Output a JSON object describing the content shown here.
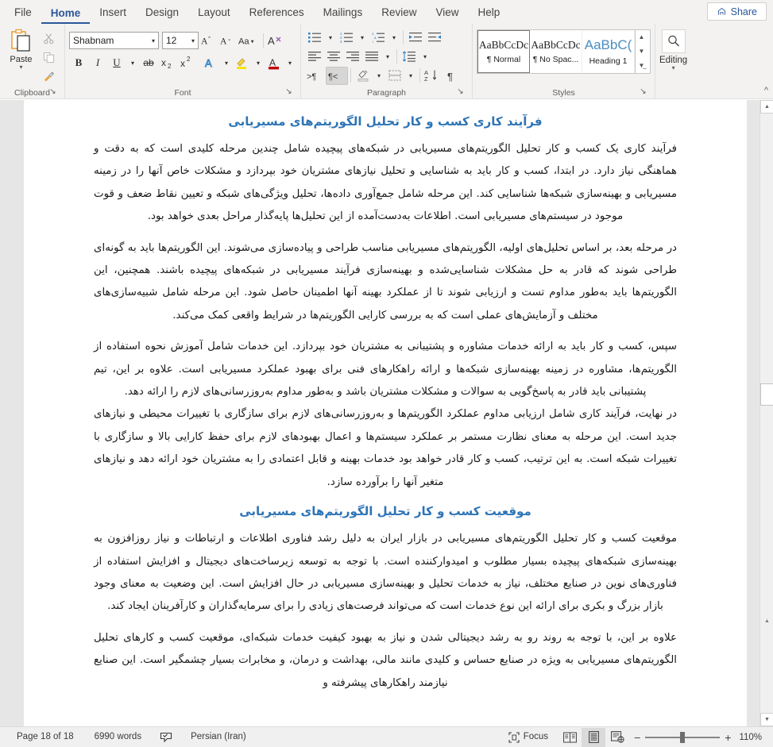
{
  "titlebar": {
    "share_label": "Share",
    "share_icon": "share-icon"
  },
  "tabs": [
    {
      "label": "File",
      "active": false
    },
    {
      "label": "Home",
      "active": true
    },
    {
      "label": "Insert",
      "active": false
    },
    {
      "label": "Design",
      "active": false
    },
    {
      "label": "Layout",
      "active": false
    },
    {
      "label": "References",
      "active": false
    },
    {
      "label": "Mailings",
      "active": false
    },
    {
      "label": "Review",
      "active": false
    },
    {
      "label": "View",
      "active": false
    },
    {
      "label": "Help",
      "active": false
    }
  ],
  "ribbon": {
    "clipboard": {
      "group_label": "Clipboard",
      "paste_label": "Paste",
      "paste_icon": "clipboard-paste-icon",
      "cut_icon": "scissors-icon",
      "copy_icon": "copy-icon",
      "format_painter_icon": "format-painter-icon",
      "dialog_launcher_icon": "dialog-launcher-icon"
    },
    "font": {
      "group_label": "Font",
      "font_name": "Shabnam",
      "font_size": "12",
      "grow_font_icon": "grow-font-icon",
      "shrink_font_icon": "shrink-font-icon",
      "change_case_icon": "change-case-icon",
      "clear_formatting_icon": "clear-formatting-icon",
      "bold_label": "B",
      "italic_label": "I",
      "underline_label": "U",
      "strikethrough_label": "ab",
      "subscript_label": "x",
      "subscript_sup": "2",
      "superscript_label": "x",
      "superscript_sup": "2",
      "text_effects_icon": "text-effects-icon",
      "highlight_icon": "text-highlight-icon",
      "font_color_icon": "font-color-icon",
      "dialog_launcher_icon": "dialog-launcher-icon"
    },
    "paragraph": {
      "group_label": "Paragraph",
      "bullets_icon": "bullet-list-icon",
      "numbering_icon": "numbered-list-icon",
      "multilevel_icon": "multilevel-list-icon",
      "decrease_indent_icon": "decrease-indent-icon",
      "increase_indent_icon": "increase-indent-icon",
      "align_left_icon": "align-left-icon",
      "align_center_icon": "align-center-icon",
      "align_right_icon": "align-right-icon",
      "justify_icon": "justify-icon",
      "line_spacing_icon": "line-spacing-icon",
      "ltr_icon": "left-to-right-text-icon",
      "rtl_icon": "right-to-left-text-icon",
      "shading_icon": "shading-icon",
      "borders_icon": "borders-icon",
      "sort_icon": "sort-icon",
      "show_marks_icon": "show-formatting-marks-icon",
      "dialog_launcher_icon": "dialog-launcher-icon"
    },
    "styles": {
      "group_label": "Styles",
      "items": [
        {
          "preview": "AaBbCcDc",
          "name": "¶ Normal",
          "selected": true
        },
        {
          "preview": "AaBbCcDc",
          "name": "¶ No Spac...",
          "selected": false
        },
        {
          "preview": "AaBbC(",
          "name": "Heading 1",
          "selected": false
        }
      ],
      "scroll_up_icon": "chevron-up-icon",
      "scroll_down_icon": "chevron-down-icon",
      "more_styles_icon": "more-styles-icon",
      "dialog_launcher_icon": "dialog-launcher-icon"
    },
    "editing": {
      "group_label": "Editing",
      "icon": "search-icon",
      "chevron_icon": "chevron-down-icon"
    },
    "collapse_icon": "collapse-ribbon-icon"
  },
  "document": {
    "blocks": [
      {
        "type": "heading",
        "text": "فرآیند کاری کسب و کار تحلیل الگوریتم‌های مسیریابی"
      },
      {
        "type": "paragraph",
        "text": "فرآیند کاری یک کسب و کار تحلیل الگوریتم‌های مسیریابی در شبکه‌های پیچیده شامل چندین مرحله کلیدی است که به دقت و هماهنگی نیاز دارد. در ابتدا، کسب و کار باید به شناسایی و تحلیل نیازهای مشتریان خود بپردازد و مشکلات خاص آنها را در زمینه مسیریابی و بهینه‌سازی شبکه‌ها شناسایی کند. این مرحله شامل جمع‌آوری داده‌ها، تحلیل ویژگی‌های شبکه و تعیین نقاط ضعف و قوت موجود در سیستم‌های مسیریابی است. اطلاعات به‌دست‌آمده از این تحلیل‌ها پایه‌گذار مراحل بعدی خواهد بود."
      },
      {
        "type": "paragraph",
        "text": "در مرحله بعد، بر اساس تحلیل‌های اولیه، الگوریتم‌های مسیریابی مناسب طراحی و پیاده‌سازی می‌شوند. این الگوریتم‌ها باید به گونه‌ای طراحی شوند که قادر به حل مشکلات شناسایی‌شده و بهینه‌سازی فرآیند مسیریابی در شبکه‌های پیچیده باشند. همچنین، این الگوریتم‌ها باید به‌طور مداوم تست و ارزیابی شوند تا از عملکرد بهینه آنها اطمینان حاصل شود. این مرحله شامل شبیه‌سازی‌های مختلف و آزمایش‌های عملی است که به بررسی کارایی الگوریتم‌ها در شرایط واقعی کمک می‌کند."
      },
      {
        "type": "paragraph",
        "text": "سپس، کسب و کار باید به ارائه خدمات مشاوره و پشتیبانی به مشتریان خود بپردازد. این خدمات شامل آموزش نحوه استفاده از الگوریتم‌ها، مشاوره در زمینه بهینه‌سازی شبکه‌ها و ارائه راهکارهای فنی برای بهبود عملکرد مسیریابی است. علاوه بر این، تیم پشتیبانی باید قادر به پاسخ‌گویی به سوالات و مشکلات مشتریان باشد و به‌طور مداوم به‌روزرسانی‌های لازم را ارائه دهد."
      },
      {
        "type": "paragraph",
        "text": "در نهایت، فرآیند کاری شامل ارزیابی مداوم عملکرد الگوریتم‌ها و به‌روزرسانی‌های لازم برای سازگاری با تغییرات محیطی و نیازهای جدید است. این مرحله به معنای نظارت مستمر بر عملکرد سیستم‌ها و اعمال بهبودهای لازم برای حفظ کارایی بالا و سازگاری با تغییرات شبکه است. به این ترتیب، کسب و کار قادر خواهد بود خدمات بهینه و قابل اعتمادی را به مشتریان خود ارائه دهد و نیازهای متغیر آنها را برآورده سازد."
      },
      {
        "type": "heading",
        "text": "موقعیت کسب و کار تحلیل الگوریتم‌های مسیریابی"
      },
      {
        "type": "paragraph",
        "text": "موقعیت کسب و کار تحلیل الگوریتم‌های مسیریابی در بازار ایران به دلیل رشد فناوری اطلاعات و ارتباطات و نیاز روزافزون به بهینه‌سازی شبکه‌های پیچیده بسیار مطلوب و امیدوارکننده است. با توجه به توسعه زیرساخت‌های دیجیتال و افزایش استفاده از فناوری‌های نوین در صنایع مختلف، نیاز به خدمات تحلیل و بهینه‌سازی مسیریابی در حال افزایش است. این وضعیت به معنای وجود بازار بزرگ و بکری برای ارائه این نوع خدمات است که می‌تواند فرصت‌های زیادی را برای سرمایه‌گذاران و کارآفرینان ایجاد کند."
      },
      {
        "type": "paragraph",
        "text": "علاوه بر این، با توجه به روند رو به رشد دیجیتالی شدن و نیاز به بهبود کیفیت خدمات شبکه‌ای، موقعیت کسب و کارهای تحلیل الگوریتم‌های مسیریابی به ویژه در صنایع حساس و کلیدی مانند مالی، بهداشت و درمان، و مخابرات بسیار چشمگیر است. این صنایع نیازمند راهکارهای پیشرفته و"
      }
    ]
  },
  "statusbar": {
    "page_info": "Page 18 of 18",
    "word_count": "6990 words",
    "proofing_icon": "proofing-errors-icon",
    "language": "Persian (Iran)",
    "focus_label": "Focus",
    "focus_icon": "focus-mode-icon",
    "read_mode_icon": "read-mode-icon",
    "print_layout_icon": "print-layout-icon",
    "web_layout_icon": "web-layout-icon",
    "zoom_out_label": "−",
    "zoom_in_label": "+",
    "zoom_level": "110%"
  },
  "colors": {
    "accent": "#2b579a",
    "heading": "#2e74b5",
    "ribbon_bg": "#f3f2f1",
    "doc_bg": "#e6e6e6"
  }
}
